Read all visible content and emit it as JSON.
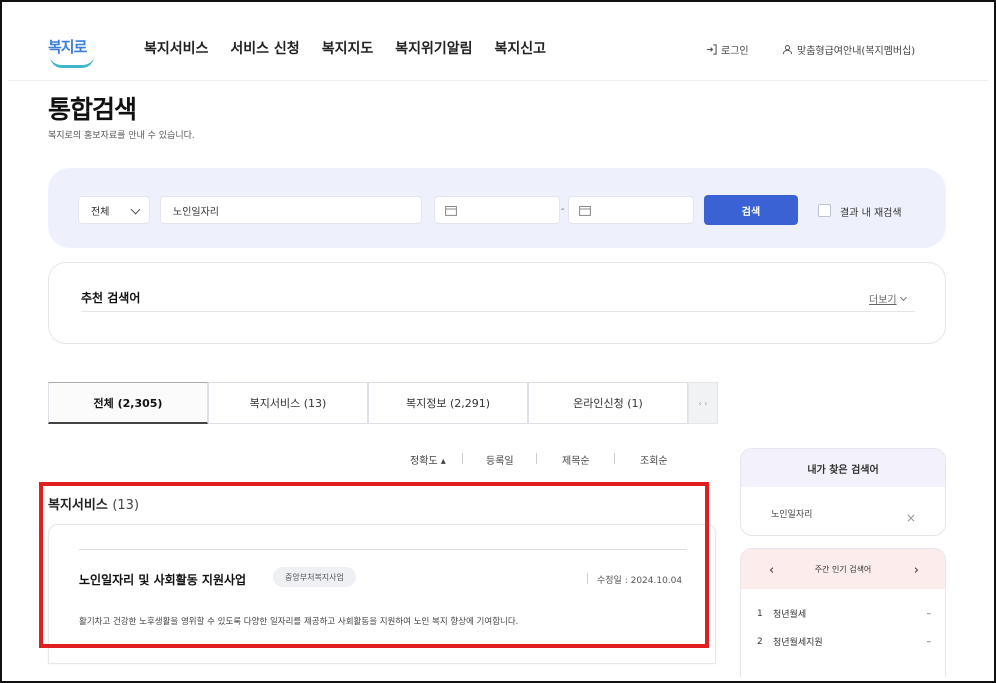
{
  "header": {
    "logo": "복지로",
    "nav": [
      "복지서비스",
      "서비스 신청",
      "복지지도",
      "복지위기알림",
      "복지신고"
    ],
    "login": "로그인",
    "member": "맞춤형급여안내(복지멤버십)"
  },
  "page": {
    "title": "통합검색",
    "description": "복지로의 홍보자료를 안내 수 있습니다."
  },
  "search": {
    "category": "전체",
    "keyword": "노인일자리",
    "date_separator": "-",
    "button": "검색",
    "within_results": "결과 내 재검색"
  },
  "recommended": {
    "title": "추천 검색어",
    "more": "더보기"
  },
  "tabs": [
    "전체 (2,305)",
    "복지서비스 (13)",
    "복지정보 (2,291)",
    "온라인신청 (1)"
  ],
  "tab_nav": "‹ ›",
  "sort": [
    "정확도 ▴",
    "등록일",
    "제목순",
    "조회순"
  ],
  "result": {
    "section_title": "복지서비스",
    "section_count": "(13)",
    "item": {
      "title": "노인일자리 및 사회활동 지원사업",
      "badge": "중앙부처복지사업",
      "date": "수정일 : 2024.10.04",
      "description": "활기차고 건강한 노후생활을 영위할 수 있도록 다양한 일자리를 제공하고 사회활동을 지원하여 노인 복지 향상에 기여합니다."
    }
  },
  "my_search": {
    "title": "내가 찾은 검색어",
    "items": [
      "노인일자리"
    ],
    "remove": "×"
  },
  "weekly": {
    "title": "주간 인기 검색어",
    "prev": "‹",
    "next": "›",
    "items": [
      {
        "rank": "1",
        "word": "청년월세",
        "trend": "–"
      },
      {
        "rank": "2",
        "word": "청년월세지원",
        "trend": "–"
      }
    ]
  },
  "colors": {
    "accent": "#3a62d4",
    "panel": "#eef1fb",
    "highlight": "#e02020"
  }
}
